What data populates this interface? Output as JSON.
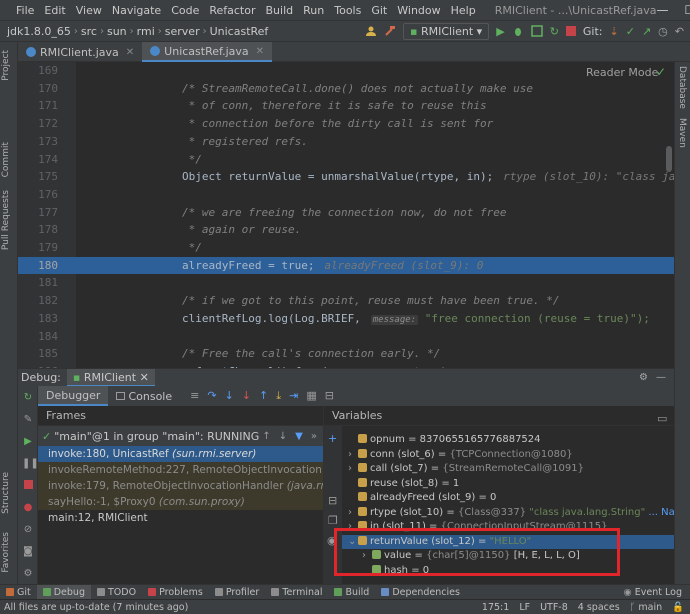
{
  "menubar": {
    "items": [
      "File",
      "Edit",
      "View",
      "Navigate",
      "Code",
      "Refactor",
      "Build",
      "Run",
      "Tools",
      "Git",
      "Window",
      "Help"
    ],
    "window_title": "RMIClient - ...\\UnicastRef.java",
    "buttons": [
      "—",
      "☐",
      "✕"
    ]
  },
  "navbar": {
    "breadcrumbs": [
      "jdk1.8.0_65",
      "src",
      "sun",
      "rmi",
      "server",
      "UnicastRef"
    ],
    "run_config": "RMIClient",
    "git_label": "Git:"
  },
  "tabs": [
    {
      "label": "RMIClient.java",
      "active": false
    },
    {
      "label": "UnicastRef.java",
      "active": true
    }
  ],
  "left_strip": {
    "labels": [
      "Project",
      "Commit",
      "Pull Requests",
      "Structure",
      "Favorites"
    ]
  },
  "right_strip": {
    "labels": [
      "Database",
      "Maven"
    ]
  },
  "editor": {
    "reader_mode": "Reader Mode",
    "lines": [
      {
        "num": "169",
        "code": ""
      },
      {
        "num": "170",
        "code": "/* StreamRemoteCall.done() does not actually make use"
      },
      {
        "num": "171",
        "code": " * of conn, therefore it is safe to reuse this"
      },
      {
        "num": "172",
        "code": " * connection before the dirty call is sent for"
      },
      {
        "num": "173",
        "code": " * registered refs."
      },
      {
        "num": "174",
        "code": " */"
      },
      {
        "num": "175",
        "code": "Object returnValue = unmarshalValue(rtype, in);",
        "hint": "rtype (slot_10): \"class java."
      },
      {
        "num": "176",
        "code": ""
      },
      {
        "num": "177",
        "code": "/* we are freeing the connection now, do not free"
      },
      {
        "num": "178",
        "code": " * again or reuse."
      },
      {
        "num": "179",
        "code": " */"
      },
      {
        "num": "180",
        "code": "alreadyFreed = true;",
        "hint": "alreadyFreed (slot_9): 0"
      },
      {
        "num": "181",
        "code": ""
      },
      {
        "num": "182",
        "code": "/* if we got to this point, reuse must have been true. */"
      },
      {
        "num": "183",
        "code": "clientRefLog.log(Log.BRIEF,",
        "hint_label": "message:",
        "hint": "\"free connection (reuse = true)\");"
      },
      {
        "num": "184",
        "code": ""
      },
      {
        "num": "185",
        "code": "/* Free the call's connection early. */"
      },
      {
        "num": "186",
        "code": "ref.getChannel().free(conn,",
        "hint_label": "reuse:",
        "hint": "true);"
      }
    ]
  },
  "debug": {
    "title": "Debug:",
    "run_tab": "RMIClient",
    "tabs": {
      "debugger": "Debugger",
      "console": "Console"
    },
    "frames_header": "Frames",
    "variables_header": "Variables",
    "thread": "\"main\"@1 in group \"main\": RUNNING",
    "frames": [
      {
        "method": "invoke:180, UnicastRef",
        "pkg": "(sun.rmi.server)",
        "kind": "sel"
      },
      {
        "method": "invokeRemoteMethod:227, RemoteObjectInvocationHandler",
        "pkg": "(s",
        "kind": "lib"
      },
      {
        "method": "invoke:179, RemoteObjectInvocationHandler",
        "pkg": "(java.rmi.server)",
        "kind": "lib"
      },
      {
        "method": "sayHello:-1, $Proxy0",
        "pkg": "(com.sun.proxy)",
        "kind": "lib"
      },
      {
        "method": "main:12, RMIClient",
        "pkg": "",
        "kind": "normal"
      }
    ],
    "variables": [
      {
        "indent": 1,
        "arrow": "",
        "icon": "#c9a04a",
        "name": "opnum",
        "value": "= 8370655165776887524",
        "ref": ""
      },
      {
        "indent": 1,
        "arrow": "›",
        "icon": "#c9a04a",
        "name": "conn (slot_6)",
        "value": "=",
        "ref": "{TCPConnection@1080}"
      },
      {
        "indent": 1,
        "arrow": "›",
        "icon": "#c9a04a",
        "name": "call (slot_7)",
        "value": "=",
        "ref": "{StreamRemoteCall@1091}"
      },
      {
        "indent": 1,
        "arrow": "",
        "icon": "#c9a04a",
        "name": "reuse (slot_8)",
        "value": "= 1",
        "ref": ""
      },
      {
        "indent": 1,
        "arrow": "",
        "icon": "#c9a04a",
        "name": "alreadyFreed (slot_9)",
        "value": "= 0",
        "ref": ""
      },
      {
        "indent": 1,
        "arrow": "›",
        "icon": "#c9a04a",
        "name": "rtype (slot_10)",
        "value": "=",
        "ref": "{Class@337}",
        "str": "\"class java.lang.String\"",
        "nav": "... Navigate"
      },
      {
        "indent": 1,
        "arrow": "›",
        "icon": "#c9a04a",
        "name": "in (slot_11)",
        "value": "=",
        "ref": "{ConnectionInputStream@1115}"
      },
      {
        "indent": 1,
        "arrow": "⌄",
        "icon": "#c9a04a",
        "name": "returnValue (slot_12)",
        "value": "=",
        "str": "\"HELLO\"",
        "sel": true
      },
      {
        "indent": 2,
        "arrow": "›",
        "icon": "#7fa95c",
        "name": "value",
        "value": "=",
        "ref": "{char[5]@1150}",
        "plain": "[H, E, L, L, O]"
      },
      {
        "indent": 2,
        "arrow": "",
        "icon": "#7fa95c",
        "name": "hash",
        "value": "= 0",
        "ref": ""
      }
    ]
  },
  "bottom_tabs": [
    {
      "label": "Git",
      "color": "#c46b3c",
      "active": false
    },
    {
      "label": "Debug",
      "color": "#5f9f5a",
      "active": true
    },
    {
      "label": "TODO",
      "color": "#8c8c8c",
      "active": false
    },
    {
      "label": "Problems",
      "color": "#c7434a",
      "active": false
    },
    {
      "label": "Profiler",
      "color": "#8c8c8c",
      "active": false
    },
    {
      "label": "Terminal",
      "color": "#8c8c8c",
      "active": false
    },
    {
      "label": "Build",
      "color": "#5f9f5a",
      "active": false
    },
    {
      "label": "Dependencies",
      "color": "#6a8cc4",
      "active": false
    }
  ],
  "event_log": "Event Log",
  "status": {
    "message": "All files are up-to-date (7 minutes ago)",
    "position": "175:1",
    "line_sep": "LF",
    "encoding": "UTF-8",
    "indent": "4 spaces",
    "branch": "main"
  }
}
